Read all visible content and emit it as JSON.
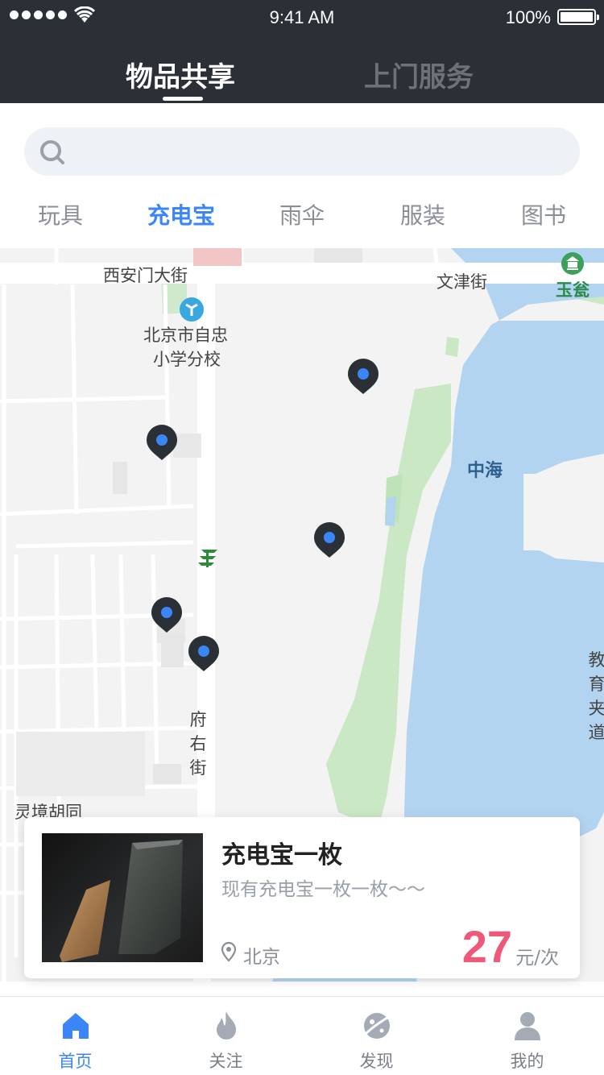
{
  "status_bar": {
    "time": "9:41 AM",
    "battery": "100%"
  },
  "header": {
    "tabs": [
      {
        "label": "物品共享",
        "active": true
      },
      {
        "label": "上门服务",
        "active": false
      }
    ]
  },
  "search": {
    "placeholder": ""
  },
  "categories": [
    {
      "label": "玩具",
      "active": false
    },
    {
      "label": "充电宝",
      "active": true
    },
    {
      "label": "雨伞",
      "active": false
    },
    {
      "label": "服装",
      "active": false
    },
    {
      "label": "图书",
      "active": false
    }
  ],
  "map": {
    "labels": {
      "xianmen": "西安门大街",
      "wenjin": "文津街",
      "yuweng": "玉瓮",
      "school_line1": "北京市自忠",
      "school_line2": "小学分校",
      "zhonghai": "中海",
      "fuyou": "府右街",
      "lingjing": "灵境胡同",
      "jiaoyu": "教育夹道"
    }
  },
  "card": {
    "title": "充电宝一枚",
    "subtitle": "现有充电宝一枚一枚～～",
    "location": "北京",
    "price": "27",
    "unit": "元/次"
  },
  "tabbar": [
    {
      "label": "首页",
      "icon": "home-icon",
      "active": true
    },
    {
      "label": "关注",
      "icon": "flame-icon",
      "active": false
    },
    {
      "label": "发现",
      "icon": "planet-icon",
      "active": false
    },
    {
      "label": "我的",
      "icon": "user-icon",
      "active": false
    }
  ],
  "colors": {
    "accent": "#3b86f7",
    "price": "#f0587a",
    "header_bg": "#2b2f36",
    "water": "#b3d4f0"
  }
}
